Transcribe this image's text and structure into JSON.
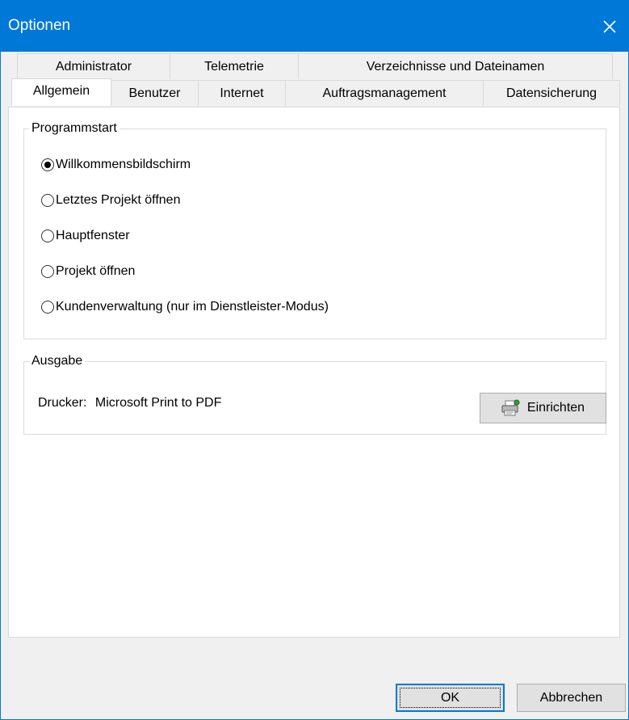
{
  "window": {
    "title": "Optionen"
  },
  "tabs": {
    "row1": [
      {
        "id": "administrator",
        "label": "Administrator"
      },
      {
        "id": "telemetrie",
        "label": "Telemetrie"
      },
      {
        "id": "verzeichnisse",
        "label": "Verzeichnisse und Dateinamen"
      }
    ],
    "row2": [
      {
        "id": "allgemein",
        "label": "Allgemein",
        "active": true
      },
      {
        "id": "benutzer",
        "label": "Benutzer"
      },
      {
        "id": "internet",
        "label": "Internet"
      },
      {
        "id": "auftragsmanagement",
        "label": "Auftragsmanagement"
      },
      {
        "id": "datensicherung",
        "label": "Datensicherung"
      }
    ]
  },
  "programmstart": {
    "label": "Programmstart",
    "options": [
      {
        "label": "Willkommensbildschirm",
        "checked": true
      },
      {
        "label": "Letztes Projekt öffnen",
        "checked": false
      },
      {
        "label": "Hauptfenster",
        "checked": false
      },
      {
        "label": "Projekt öffnen",
        "checked": false
      },
      {
        "label": "Kundenverwaltung (nur im Dienstleister-Modus)",
        "checked": false
      }
    ]
  },
  "ausgabe": {
    "label": "Ausgabe",
    "printer_label": "Drucker:",
    "printer_value": "Microsoft Print to PDF",
    "setup_button": "Einrichten",
    "setup_icon": "printer-setup-icon"
  },
  "buttons": {
    "ok": "OK",
    "cancel": "Abbrechen"
  },
  "colors": {
    "titlebar": "#0078d7",
    "background": "#f0f0f0",
    "panel": "#ffffff"
  }
}
